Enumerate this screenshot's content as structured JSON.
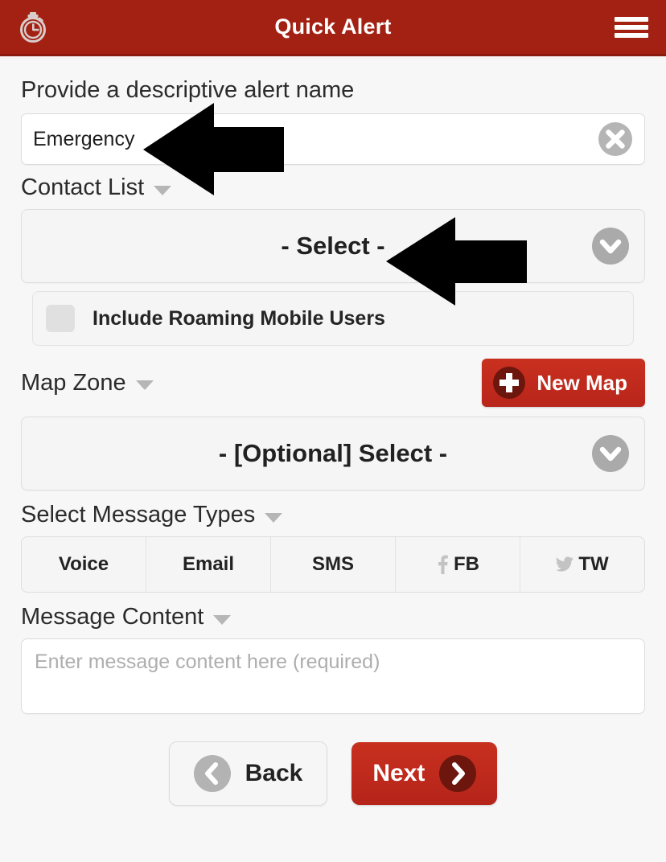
{
  "header": {
    "title": "Quick Alert",
    "logo_icon": "stopwatch-icon",
    "menu_icon": "hamburger-menu-icon",
    "brand_color": "#a32113"
  },
  "alert_name": {
    "label": "Provide a descriptive alert name",
    "value": "Emergency",
    "placeholder": "",
    "clear_icon": "clear-circle-x-icon"
  },
  "contact_list": {
    "label": "Contact List",
    "selected": "- Select -",
    "chevron_icon": "chevron-down-circle-icon",
    "roaming": {
      "label": "Include Roaming Mobile Users",
      "checked": false
    }
  },
  "map_zone": {
    "label": "Map Zone",
    "new_map_label": "New Map",
    "new_map_icon": "plus-circle-icon",
    "selected": "- [Optional] Select -",
    "chevron_icon": "chevron-down-circle-icon"
  },
  "message_types": {
    "label": "Select Message Types",
    "types": [
      {
        "label": "Voice",
        "icon": null
      },
      {
        "label": "Email",
        "icon": null
      },
      {
        "label": "SMS",
        "icon": null
      },
      {
        "label": "FB",
        "icon": "facebook-icon"
      },
      {
        "label": "TW",
        "icon": "twitter-icon"
      }
    ]
  },
  "message_content": {
    "label": "Message Content",
    "value": "",
    "placeholder": "Enter message content here (required)"
  },
  "footer": {
    "back_label": "Back",
    "back_icon": "chevron-left-circle-icon",
    "next_label": "Next",
    "next_icon": "chevron-right-circle-icon",
    "next_color": "#c0281c"
  },
  "annotations": [
    {
      "name": "arrow-pointing-to-alert-name-input",
      "direction": "left"
    },
    {
      "name": "arrow-pointing-to-contact-list-select",
      "direction": "left"
    }
  ]
}
